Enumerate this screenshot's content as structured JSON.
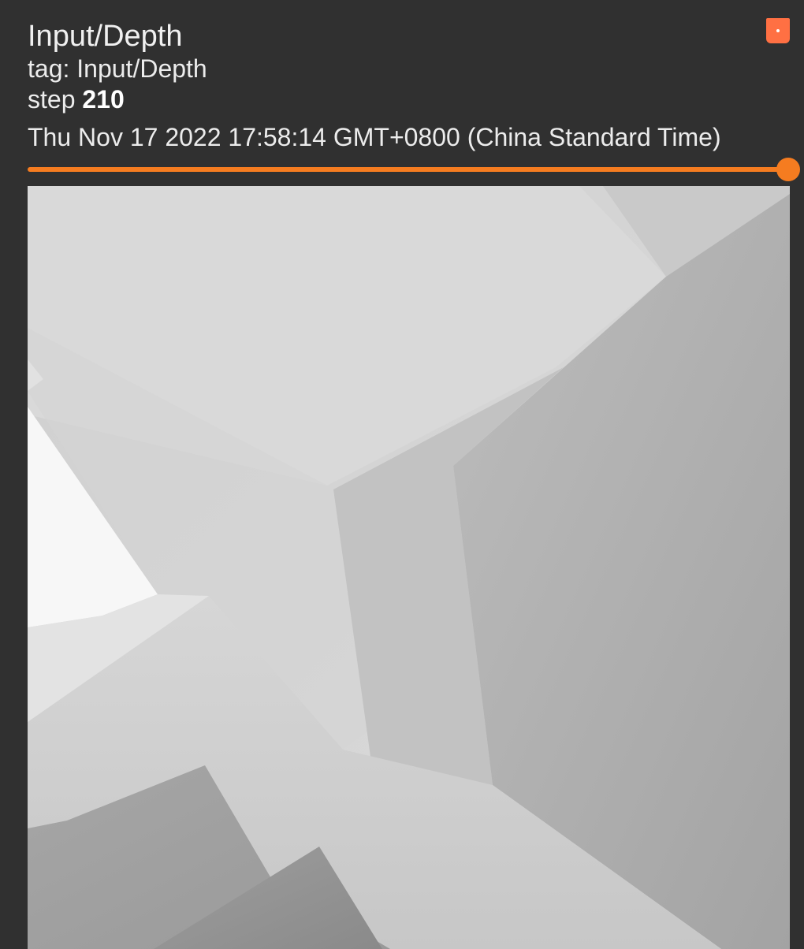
{
  "card": {
    "title": "Input/Depth",
    "tag_label": "tag: Input/Depth",
    "step_prefix": "step",
    "step_value": "210",
    "timestamp": "Thu Nov 17 2022 17:58:14 GMT+0800 (China Standard Time)"
  },
  "expand_button": {
    "icon": "expand-icon",
    "color": "#ff7043"
  },
  "step_slider": {
    "position_fraction": 1.0,
    "color": "#f57c20"
  },
  "image": {
    "kind": "grayscale depth map"
  }
}
